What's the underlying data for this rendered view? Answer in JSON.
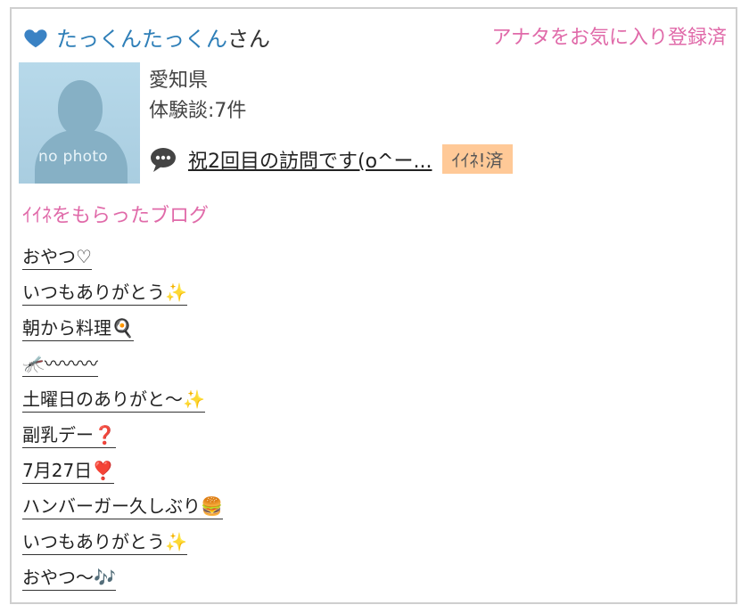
{
  "header": {
    "user_name": "たっくんたっくん",
    "user_suffix": "さん",
    "favorite_status": "アナタをお気に入り登録済"
  },
  "profile": {
    "avatar_text": "no photo",
    "prefecture": "愛知県",
    "review_count": "体験談:7件",
    "latest_review_title": "祝2回目の訪問です(o^ー...",
    "liked_badge": "ｲｲﾈ!済"
  },
  "liked_blogs": {
    "title": "ｲｲﾈをもらったブログ",
    "items": [
      "おやつ♡",
      "いつもありがとう✨",
      "朝から料理🍳",
      "🦟〰〰〰",
      "土曜日のありがと～✨",
      "副乳デー❓",
      "7月27日❣️",
      "ハンバーガー久しぶり🍔",
      "いつもありがとう✨",
      "おやつ～🎶"
    ]
  },
  "colors": {
    "accent_pink": "#e06aa9",
    "name_blue": "#2f7fb8",
    "heart_blue": "#3a82c4",
    "badge_orange": "#ffc997"
  },
  "icons": {
    "heart": "heart-icon",
    "chat": "chat-bubble-icon"
  }
}
